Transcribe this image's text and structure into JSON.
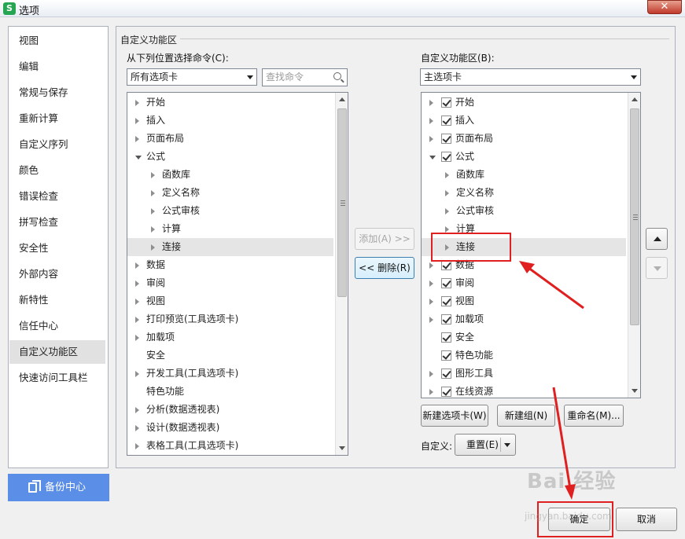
{
  "window": {
    "title": "选项",
    "app_icon_letter": "S",
    "close_label": "✕"
  },
  "sidebar": {
    "items": [
      {
        "label": "视图"
      },
      {
        "label": "编辑"
      },
      {
        "label": "常规与保存"
      },
      {
        "label": "重新计算"
      },
      {
        "label": "自定义序列"
      },
      {
        "label": "颜色"
      },
      {
        "label": "错误检查"
      },
      {
        "label": "拼写检查"
      },
      {
        "label": "安全性"
      },
      {
        "label": "外部内容"
      },
      {
        "label": "新特性"
      },
      {
        "label": "信任中心"
      },
      {
        "label": "自定义功能区"
      },
      {
        "label": "快速访问工具栏"
      }
    ],
    "active_index": 12,
    "backup_label": "备份中心"
  },
  "panel": {
    "group_title": "自定义功能区",
    "left_label": "从下列位置选择命令(C):",
    "left_combo_value": "所有选项卡",
    "search_placeholder": "查找命令",
    "right_label": "自定义功能区(B):",
    "right_combo_value": "主选项卡",
    "left_tree": [
      {
        "label": "开始",
        "indent": 0,
        "tw": "closed"
      },
      {
        "label": "插入",
        "indent": 0,
        "tw": "closed"
      },
      {
        "label": "页面布局",
        "indent": 0,
        "tw": "closed"
      },
      {
        "label": "公式",
        "indent": 0,
        "tw": "open"
      },
      {
        "label": "函数库",
        "indent": 1,
        "tw": "closed"
      },
      {
        "label": "定义名称",
        "indent": 1,
        "tw": "closed"
      },
      {
        "label": "公式审核",
        "indent": 1,
        "tw": "closed"
      },
      {
        "label": "计算",
        "indent": 1,
        "tw": "closed"
      },
      {
        "label": "连接",
        "indent": 1,
        "tw": "closed",
        "selected": true
      },
      {
        "label": "数据",
        "indent": 0,
        "tw": "closed"
      },
      {
        "label": "审阅",
        "indent": 0,
        "tw": "closed"
      },
      {
        "label": "视图",
        "indent": 0,
        "tw": "closed"
      },
      {
        "label": "打印预览(工具选项卡)",
        "indent": 0,
        "tw": "closed"
      },
      {
        "label": "加载项",
        "indent": 0,
        "tw": "closed"
      },
      {
        "label": "安全",
        "indent": 0,
        "tw": "none"
      },
      {
        "label": "开发工具(工具选项卡)",
        "indent": 0,
        "tw": "closed"
      },
      {
        "label": "特色功能",
        "indent": 0,
        "tw": "none"
      },
      {
        "label": "分析(数据透视表)",
        "indent": 0,
        "tw": "closed"
      },
      {
        "label": "设计(数据透视表)",
        "indent": 0,
        "tw": "closed"
      },
      {
        "label": "表格工具(工具选项卡)",
        "indent": 0,
        "tw": "closed"
      }
    ],
    "right_tree": [
      {
        "label": "开始",
        "indent": 0,
        "tw": "closed",
        "checked": true
      },
      {
        "label": "插入",
        "indent": 0,
        "tw": "closed",
        "checked": true
      },
      {
        "label": "页面布局",
        "indent": 0,
        "tw": "closed",
        "checked": true
      },
      {
        "label": "公式",
        "indent": 0,
        "tw": "open",
        "checked": true
      },
      {
        "label": "函数库",
        "indent": 1,
        "tw": "closed"
      },
      {
        "label": "定义名称",
        "indent": 1,
        "tw": "closed"
      },
      {
        "label": "公式审核",
        "indent": 1,
        "tw": "closed"
      },
      {
        "label": "计算",
        "indent": 1,
        "tw": "closed"
      },
      {
        "label": "连接",
        "indent": 1,
        "tw": "closed",
        "selected": true
      },
      {
        "label": "数据",
        "indent": 0,
        "tw": "closed",
        "checked": true
      },
      {
        "label": "审阅",
        "indent": 0,
        "tw": "closed",
        "checked": true
      },
      {
        "label": "视图",
        "indent": 0,
        "tw": "closed",
        "checked": true
      },
      {
        "label": "加载项",
        "indent": 0,
        "tw": "closed",
        "checked": true
      },
      {
        "label": "安全",
        "indent": 0,
        "tw": "none",
        "checked": true
      },
      {
        "label": "特色功能",
        "indent": 0,
        "tw": "none",
        "checked": true
      },
      {
        "label": "图形工具",
        "indent": 0,
        "tw": "closed",
        "checked": true
      },
      {
        "label": "在线资源",
        "indent": 0,
        "tw": "closed",
        "checked": true
      }
    ],
    "add_button": "添加(A) >>",
    "remove_button": "<< 删除(R)",
    "new_tab_button": "新建选项卡(W)",
    "new_group_button": "新建组(N)",
    "rename_button": "重命名(M)...",
    "custom_label": "自定义:",
    "reset_button": "重置(E)"
  },
  "footer": {
    "ok_button": "确定",
    "cancel_button": "取消"
  },
  "watermark": {
    "text": "Bai 经验",
    "sub": "jingyan.baidu.com"
  },
  "colors": {
    "accent_blue": "#5b8ee6",
    "annotation_red": "#e02020",
    "selection_gray": "#e5e5e5"
  }
}
